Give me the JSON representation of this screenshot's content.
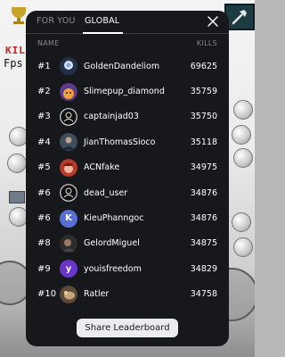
{
  "tabs": {
    "for_you": "FOR YOU",
    "global": "GLOBAL"
  },
  "columns": {
    "name": "NAME",
    "kills": "KILLS"
  },
  "background": {
    "kill_text": "KIL",
    "fps_text": "Fps"
  },
  "rows": [
    {
      "rank": "#1",
      "name": "GoldenDandeliom",
      "kills": "69625",
      "avatar": "dandelion-avatar"
    },
    {
      "rank": "#2",
      "name": "Slimepup_diamond",
      "kills": "35759",
      "avatar": "slimepup-avatar"
    },
    {
      "rank": "#3",
      "name": "captainjad03",
      "kills": "35750",
      "avatar": "default-avatar"
    },
    {
      "rank": "#4",
      "name": "JianThomasSioco",
      "kills": "35118",
      "avatar": "photo-avatar"
    },
    {
      "rank": "#5",
      "name": "ACNfake",
      "kills": "34975",
      "avatar": "acnfake-avatar"
    },
    {
      "rank": "#6",
      "name": "dead_user",
      "kills": "34876",
      "avatar": "default-avatar"
    },
    {
      "rank": "#6",
      "name": "KieuPhanngoc",
      "kills": "34876",
      "avatar": "letter-avatar",
      "letter": "K",
      "color": "#5a6fd6"
    },
    {
      "rank": "#8",
      "name": "GelordMiguel",
      "kills": "34875",
      "avatar": "photo-avatar"
    },
    {
      "rank": "#9",
      "name": "youisfreedom",
      "kills": "34829",
      "avatar": "letter-avatar",
      "letter": "y",
      "color": "#6a36c9"
    },
    {
      "rank": "#10",
      "name": "Ratler",
      "kills": "34758",
      "avatar": "photo-avatar"
    }
  ],
  "share_button": "Share Leaderboard",
  "colors": {
    "panel": "#17181b",
    "text": "#ffffff",
    "muted": "#8c8c90",
    "button": "#ececf0"
  }
}
